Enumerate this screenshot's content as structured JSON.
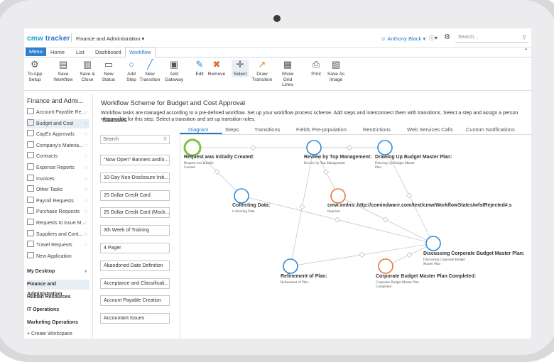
{
  "app": {
    "logo_main": "cmw",
    "logo_sub": "tracker",
    "breadcrumb": "Finance and Administration",
    "user": "Anthony Black",
    "search_placeholder": "Search..."
  },
  "tabs": {
    "menu": "Menu",
    "items": [
      "Home",
      "List",
      "Dashboard",
      "Workflow"
    ],
    "active": "Workflow"
  },
  "ribbon": [
    {
      "label": "To App\nSetup",
      "icon": "gears-icon"
    },
    {
      "label": "Save\nWorkflow",
      "icon": "save-icon"
    },
    {
      "label": "Save &\nClose",
      "icon": "save-close-icon"
    },
    {
      "label": "New\nStatus",
      "icon": "new-status-icon"
    },
    {
      "label": "Add\nStep",
      "icon": "add-step-icon"
    },
    {
      "label": "New\nTransition",
      "icon": "new-transition-icon"
    },
    {
      "label": "Add\nGateway",
      "icon": "add-gateway-icon"
    },
    {
      "label": "Edit",
      "icon": "edit-icon"
    },
    {
      "label": "Remove",
      "icon": "remove-icon"
    },
    {
      "label": "Select",
      "icon": "select-icon"
    },
    {
      "label": "Draw\nTransition",
      "icon": "draw-transition-icon"
    },
    {
      "label": "Show Grid\nLines",
      "icon": "grid-icon"
    },
    {
      "label": "Print",
      "icon": "print-icon"
    },
    {
      "label": "Save As\nImage",
      "icon": "save-image-icon"
    }
  ],
  "sidebar": {
    "title": "Finance and Admi...",
    "items": [
      "Account Payable Re...",
      "Budget and Cost",
      "CapEx Approvals",
      "Company's Materia...",
      "Contracts",
      "Expense Reports",
      "Invoices",
      "Other Tasks",
      "Payroll Requests",
      "Purchase Requests",
      "Requests to issue M...",
      "Suppliers and Cont...",
      "Travel Requests",
      "New Application"
    ],
    "active_item": "Budget and Cost",
    "sections": [
      "My Desktop",
      "Finance and Administration",
      "Human Resources",
      "IT Operations",
      "Marketing Operations"
    ],
    "create": "Create Workspace"
  },
  "statuses": {
    "title": "Statuses",
    "search_placeholder": "Search",
    "items": [
      "\"Now Open\" Banners and/o...",
      "10-Day Non-Disclosure Initi...",
      "25 Dollar Credit Card",
      "25 Dollar Credit Card (Mock...",
      "3th Week of Training",
      "4 Pager",
      "Abandoned Date Definition",
      "Acceptance and Classificati...",
      "Account Payable Creation",
      "Accountant Issues"
    ]
  },
  "main": {
    "title": "Workflow Scheme for Budget and Cost Approval",
    "description": "Workflow tasks are managed according to a pre-defined workflow. Set up your workflow process scheme. Add steps and interconnect them with transitions. Select a step and assign a person responsible for this step. Select a transition and set up transition rules.",
    "tabs": [
      "Diagram",
      "Steps",
      "Transitions",
      "Fields Pre-population",
      "Restrictions",
      "Web Services Calls",
      "Custom Notifications"
    ],
    "active_tab": "Diagram"
  },
  "diagram": {
    "nodes": [
      {
        "label": "Request was Initially Created:",
        "sub": "Request was Initially\nCreated",
        "color": "#7fc241"
      },
      {
        "label": "Review by Top Management:",
        "sub": "Review by Top Management",
        "color": "#2e8bd6"
      },
      {
        "label": "Drawing Up Budget Master Plan:",
        "sub": "Drawing Up Budget Master\nPlan",
        "color": "#2e8bd6"
      },
      {
        "label": "Collecting Data:",
        "sub": "Collecting Data",
        "color": "#2e8bd6"
      },
      {
        "label": "cmw.xmlns:.http://comindware.com/text/cmw/WorkflowStates/wfstRejected#.s",
        "sub": "Rejected",
        "color": "#e8763a"
      },
      {
        "label": "Discussing Corporate Budget Master Plan:",
        "sub": "Discussing Corporate Budget\nMaster Plan",
        "color": "#2e8bd6"
      },
      {
        "label": "Refinement of Plan:",
        "sub": "Refinement of Plan",
        "color": "#2e8bd6"
      },
      {
        "label": "Corporate Budget Master Plan Completed:",
        "sub": "Corporate Budget Master Plan\nCompleted",
        "color": "#e8763a"
      }
    ]
  }
}
